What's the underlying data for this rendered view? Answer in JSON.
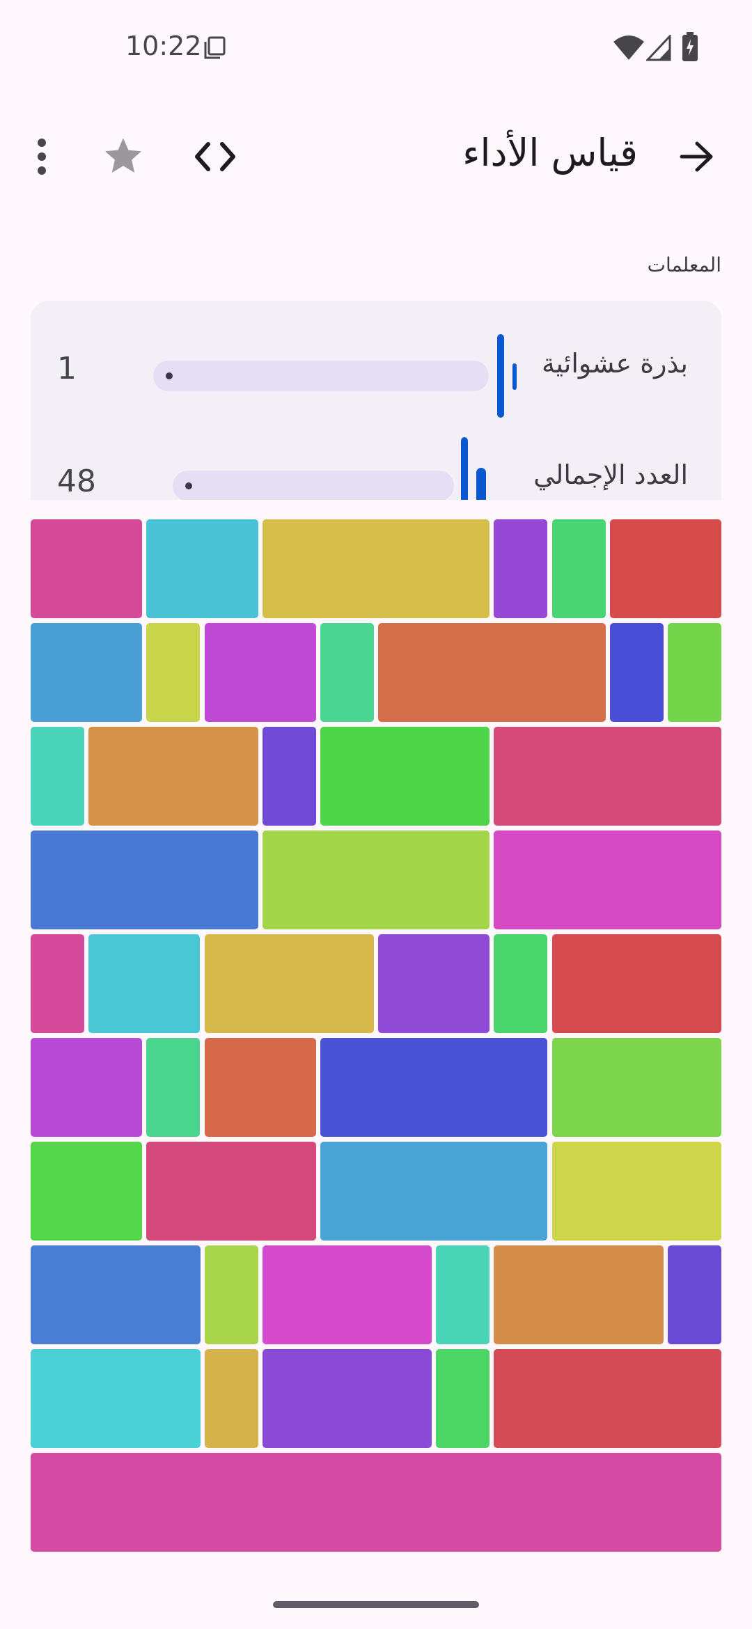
{
  "status_bar": {
    "time": "10:22",
    "icons": [
      "screenshot-icon",
      "wifi-icon",
      "signal-icon",
      "battery-charging-icon"
    ]
  },
  "app_bar": {
    "title": "قياس الأداء",
    "back_icon": "arrow-forward-icon",
    "code_icon": "code-icon",
    "star_icon": "star-icon",
    "menu_icon": "more-vert-icon"
  },
  "parameters": {
    "section_label": "المعلمات",
    "items": [
      {
        "label": "بذرة عشوائية",
        "value": "1"
      },
      {
        "label": "العدد الإجمالي",
        "value": "48"
      }
    ]
  },
  "colors": {
    "background": "#fef7fb",
    "card": "#f2f0f6",
    "accent": "#0b57d0",
    "track": "#e6def5"
  },
  "tiles": [
    [
      "#d54a98",
      "#49c2d5",
      "#d5bf4a",
      "#9649d5",
      "#4ad575",
      "#d54a4a"
    ],
    [
      "#4a9fd5",
      "#c8d54a",
      "#c04ad5",
      "#4ad593",
      "#d56e4a",
      "#4a4dd5",
      "#74d54a"
    ],
    [
      "#4ad5bb",
      "#d5934a",
      "#6e4ad5",
      "#4fd54a",
      "#d54a78"
    ],
    [
      "#4a78d5",
      "#a3d54a",
      "#d54ac3"
    ],
    [
      "#d54a9b",
      "#4ac7d5",
      "#d5b74a",
      "#914ad5",
      "#4ad56c",
      "#d54a4f"
    ],
    [
      "#b84ad5",
      "#4ad58f",
      "#d5694a",
      "#4a52d5",
      "#7cd54a"
    ],
    [
      "#55d54a",
      "#d54a7d",
      "#4aa4d5",
      "#cdd54a"
    ],
    [
      "#4a7ed5",
      "#a9d54a",
      "#d54acd",
      "#4ad5b6",
      "#d58e4a",
      "#684ad5"
    ],
    [
      "#4ad0d5",
      "#d5b34a",
      "#8a4ad5",
      "#4ad564",
      "#d54a57"
    ],
    [
      "#d54aa3"
    ]
  ]
}
